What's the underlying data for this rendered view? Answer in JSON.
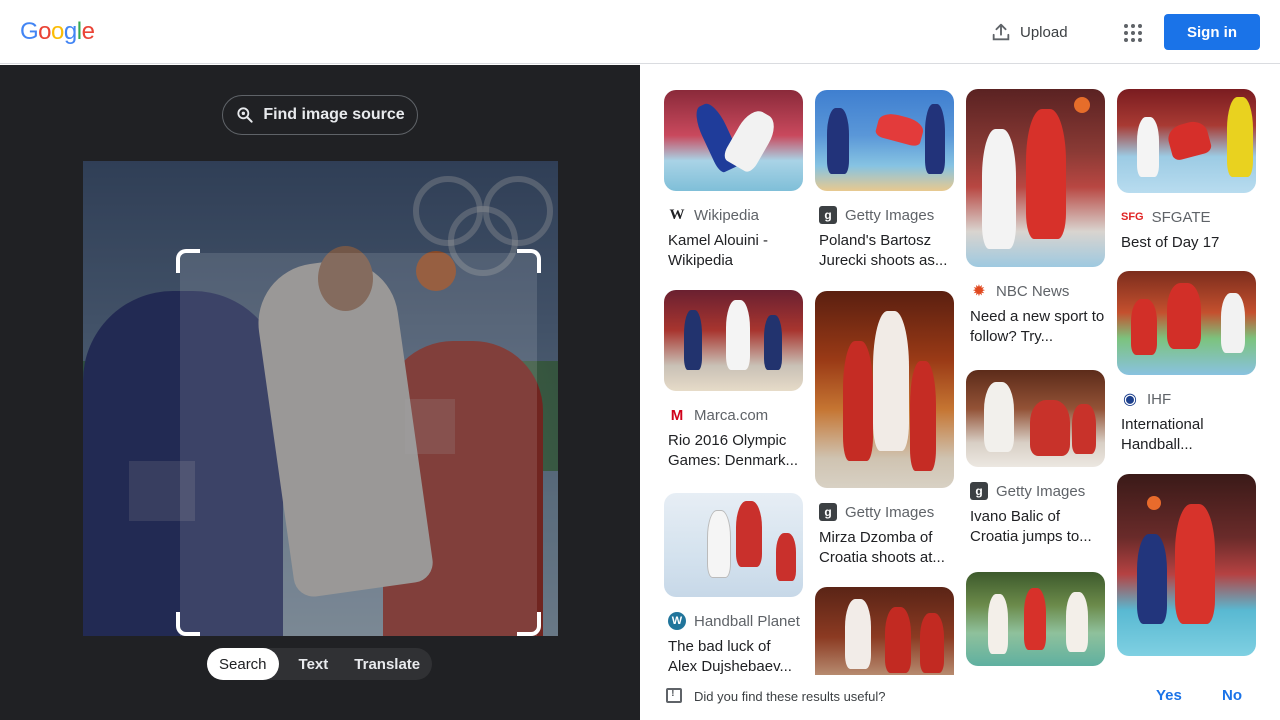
{
  "header": {
    "logo": [
      "G",
      "o",
      "o",
      "g",
      "l",
      "e"
    ],
    "logo_colors": [
      "#4285F4",
      "#EA4335",
      "#FBBC05",
      "#4285F4",
      "#34A853",
      "#EA4335"
    ],
    "upload_label": "Upload",
    "signin_label": "Sign in"
  },
  "lens": {
    "find_source_label": "Find image source",
    "modes": [
      "Search",
      "Text",
      "Translate"
    ],
    "active_mode": "Search"
  },
  "results": [
    {
      "source": "Wikipedia",
      "icon": "wikipedia-icon",
      "glyph": "W",
      "title": "Kamel Alouini - Wikipedia"
    },
    {
      "source": "Getty Images",
      "icon": "getty-icon",
      "glyph": "g",
      "title": "Poland's Bartosz Jurecki shoots as..."
    },
    {
      "source": "NBC News",
      "icon": "nbc-peacock-icon",
      "glyph": "✹",
      "title": "Need a new sport to follow? Try..."
    },
    {
      "source": "SFGATE",
      "icon": "sfgate-icon",
      "glyph": "SFG",
      "title": "Best of Day 17"
    },
    {
      "source": "Marca.com",
      "icon": "marca-icon",
      "glyph": "M",
      "title": "Rio 2016 Olympic Games: Denmark..."
    },
    {
      "source": "Getty Images",
      "icon": "getty-icon",
      "glyph": "g",
      "title": "Mirza Dzomba of Croatia shoots at..."
    },
    {
      "source": "Getty Images",
      "icon": "getty-icon",
      "glyph": "g",
      "title": "Ivano Balic of Croatia jumps to..."
    },
    {
      "source": "IHF",
      "icon": "ihf-icon",
      "glyph": "◉",
      "title": "International Handball..."
    },
    {
      "source": "Handball Planet",
      "icon": "wordpress-icon",
      "glyph": "W",
      "title": "The bad luck of Alex Dujshebaev..."
    }
  ],
  "feedback": {
    "question": "Did you find these results useful?",
    "yes": "Yes",
    "no": "No"
  }
}
